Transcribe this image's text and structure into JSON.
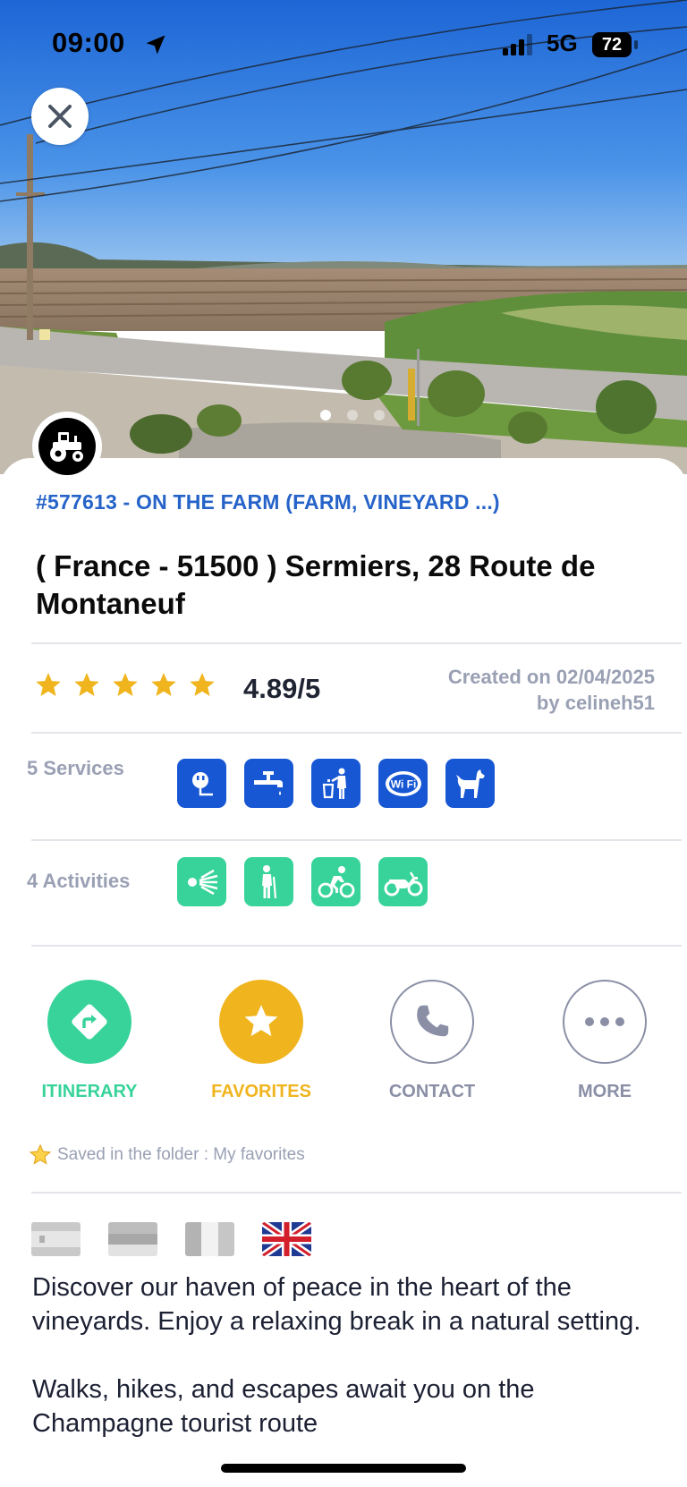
{
  "status_bar": {
    "time": "09:00",
    "network": "5G",
    "battery": "72"
  },
  "hero": {
    "photo": "vineyard-roadside-photo",
    "carousel_pages": 3,
    "active_page": 1
  },
  "place": {
    "category": "#577613 - ON THE FARM (FARM, VINEYARD ...)",
    "title": "( France - 51500 ) Sermiers, 28 Route de Montaneuf",
    "type_icon": "tractor-icon"
  },
  "rating": {
    "stars": 5,
    "value": "4.89/5",
    "color": "#f0b51e"
  },
  "created": {
    "date": "Created on 02/04/2025",
    "author": "by celineh51"
  },
  "services": {
    "label": "5 Services",
    "color": "#1757d4",
    "icons": [
      "electricity-icon",
      "water-tap-icon",
      "trash-disposal-icon",
      "wifi-icon",
      "dog-icon"
    ]
  },
  "activities": {
    "label": "4 Activities",
    "color": "#37d39a",
    "icons": [
      "viewpoint-icon",
      "hiking-icon",
      "cycling-icon",
      "motorbike-icon"
    ]
  },
  "actions": {
    "itinerary": {
      "label": "ITINERARY",
      "color": "#37d39a"
    },
    "favorites": {
      "label": "FAVORITES",
      "color": "#f0b51e"
    },
    "contact": {
      "label": "CONTACT",
      "color": "#8a8fa6"
    },
    "more": {
      "label": "MORE",
      "color": "#8a8fa6"
    }
  },
  "saved_note": "Saved in the folder : My favorites",
  "languages": [
    "spain-flag",
    "generic-flag",
    "generic-vertical-flag",
    "uk-flag"
  ],
  "description": [
    "Discover our haven of peace in the heart of the vineyards. Enjoy a relaxing break in a natural setting.",
    "Walks, hikes, and escapes await you on the Champagne tourist route"
  ]
}
